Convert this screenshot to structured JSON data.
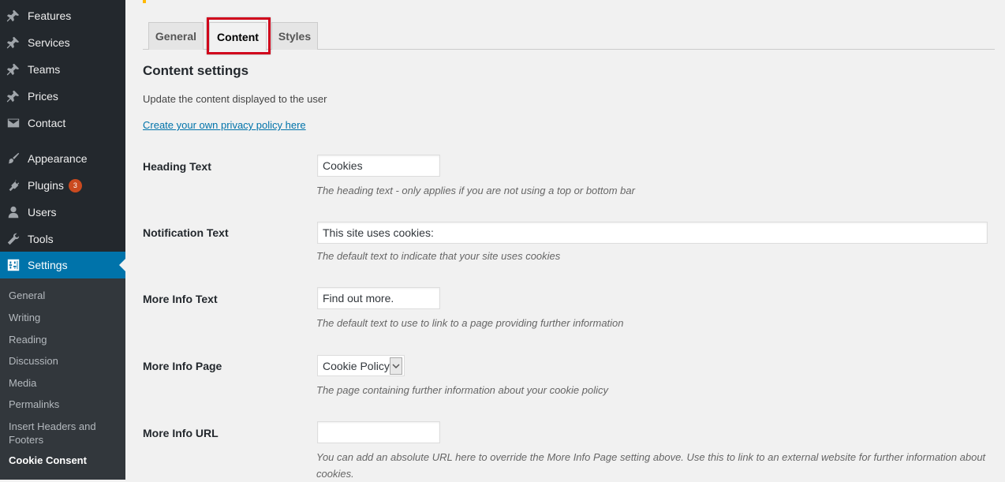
{
  "sidebar": {
    "items": [
      {
        "label": "Features",
        "icon": "pin-icon"
      },
      {
        "label": "Services",
        "icon": "pin-icon"
      },
      {
        "label": "Teams",
        "icon": "pin-icon"
      },
      {
        "label": "Prices",
        "icon": "pin-icon"
      },
      {
        "label": "Contact",
        "icon": "envelope-icon"
      },
      {
        "label": "Appearance",
        "icon": "paintbrush-icon"
      },
      {
        "label": "Plugins",
        "icon": "plug-icon",
        "badge": "3"
      },
      {
        "label": "Users",
        "icon": "user-icon"
      },
      {
        "label": "Tools",
        "icon": "wrench-icon"
      },
      {
        "label": "Settings",
        "icon": "settings-icon"
      }
    ],
    "submenu": [
      {
        "label": "General"
      },
      {
        "label": "Writing"
      },
      {
        "label": "Reading"
      },
      {
        "label": "Discussion"
      },
      {
        "label": "Media"
      },
      {
        "label": "Permalinks"
      },
      {
        "label": "Insert Headers and Footers"
      },
      {
        "label": "Cookie Consent"
      }
    ],
    "active_item": "Settings",
    "active_subitem": "Cookie Consent",
    "colors": {
      "bg": "#23282d",
      "active": "#0073aa",
      "badge": "#ca4a1f"
    }
  },
  "tabs": [
    {
      "label": "General"
    },
    {
      "label": "Content"
    },
    {
      "label": "Styles"
    }
  ],
  "active_tab": "Content",
  "highlight_color": "#d0021b",
  "content": {
    "title": "Content settings",
    "description": "Update the content displayed to the user",
    "privacy_link": "Create your own privacy policy here",
    "fields": {
      "heading_text": {
        "label": "Heading Text",
        "value": "Cookies",
        "hint": "The heading text - only applies if you are not using a top or bottom bar"
      },
      "notification_text": {
        "label": "Notification Text",
        "value": "This site uses cookies:",
        "hint": "The default text to indicate that your site uses cookies"
      },
      "more_info_text": {
        "label": "More Info Text",
        "value": "Find out more.",
        "hint": "The default text to use to link to a page providing further information"
      },
      "more_info_page": {
        "label": "More Info Page",
        "value": "Cookie Policy",
        "hint": "The page containing further information about your cookie policy"
      },
      "more_info_url": {
        "label": "More Info URL",
        "value": "",
        "hint": "You can add an absolute URL here to override the More Info Page setting above. Use this to link to an external website for further information about cookies."
      }
    }
  }
}
